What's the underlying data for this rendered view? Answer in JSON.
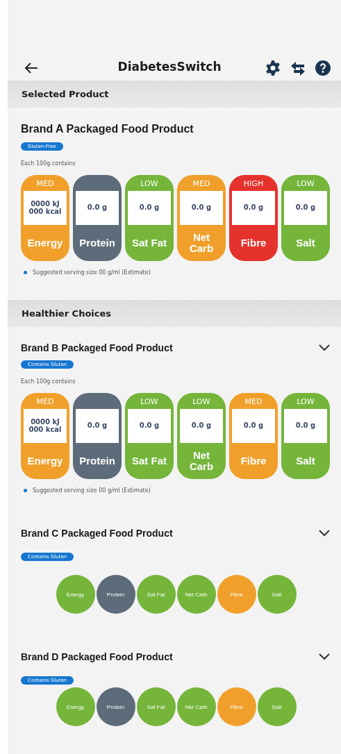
{
  "app_bar": {
    "title": "DiabetesSwitch"
  },
  "sections": [
    {
      "heading": "Selected Product",
      "products": [
        {
          "name": "Brand A Packaged Food Product",
          "kind": "detailed",
          "toggle": false,
          "badge": "Gluten-Free",
          "per": "Each 100g contains",
          "note": "Suggested serving size 00 g/ml (Estimate)",
          "nutrients": [
            {
              "name": "Energy",
              "rating": "MED",
              "amount": "0000 kJ\n000 kcal",
              "color": "#f0a02a"
            },
            {
              "name": "Protein",
              "amount": "0.0 g",
              "color": "#5d6b7a"
            },
            {
              "name": "Sat Fat",
              "rating": "LOW",
              "amount": "0.0 g",
              "color": "#74b53a"
            },
            {
              "name": "Net Carb",
              "rating": "MED",
              "amount": "0.0 g",
              "color": "#f0a02a"
            },
            {
              "name": "Fibre",
              "rating": "HIGH",
              "amount": "0.0 g",
              "color": "#e5322d"
            },
            {
              "name": "Salt",
              "rating": "LOW",
              "amount": "0.0 g",
              "color": "#74b53a"
            }
          ]
        }
      ]
    },
    {
      "heading": "Healthier Choices",
      "products": [
        {
          "name": "Brand B Packaged Food Product",
          "kind": "detailed",
          "toggle": true,
          "badge": "Contains Gluten",
          "per": "Each 100g contains",
          "note": "Suggested serving size 00 g/ml (Estimate)",
          "nutrients": [
            {
              "name": "Energy",
              "rating": "MED",
              "amount": "0000 kJ\n000 kcal",
              "color": "#f0a02a"
            },
            {
              "name": "Protein",
              "amount": "0.0 g",
              "color": "#5d6b7a"
            },
            {
              "name": "Sat Fat",
              "rating": "LOW",
              "amount": "0.0 g",
              "color": "#74b53a"
            },
            {
              "name": "Net Carb",
              "rating": "LOW",
              "amount": "0.0 g",
              "color": "#74b53a"
            },
            {
              "name": "Fibre",
              "rating": "MED",
              "amount": "0.0 g",
              "color": "#f0a02a"
            },
            {
              "name": "Salt",
              "rating": "LOW",
              "amount": "0.0 g",
              "color": "#74b53a"
            }
          ]
        },
        {
          "name": "Brand C Packaged Food Product",
          "kind": "compact",
          "toggle": true,
          "badge": "Contains Gluten",
          "nutrients": [
            {
              "name": "Energy",
              "color": "#74b53a"
            },
            {
              "name": "Protein",
              "color": "#5d6b7a"
            },
            {
              "name": "Sat Fat",
              "color": "#74b53a"
            },
            {
              "name": "Net Carb",
              "color": "#74b53a"
            },
            {
              "name": "Fibre",
              "color": "#f0a02a"
            },
            {
              "name": "Salt",
              "color": "#74b53a"
            }
          ]
        },
        {
          "name": "Brand D Packaged Food Product",
          "kind": "compact",
          "toggle": true,
          "badge": "Contains Gluten",
          "nutrients": [
            {
              "name": "Energy",
              "color": "#74b53a"
            },
            {
              "name": "Protein",
              "color": "#5d6b7a"
            },
            {
              "name": "Sat Fat",
              "color": "#74b53a"
            },
            {
              "name": "Net Carb",
              "color": "#74b53a"
            },
            {
              "name": "Fibre",
              "color": "#f0a02a"
            },
            {
              "name": "Salt",
              "color": "#74b53a"
            }
          ]
        }
      ]
    }
  ]
}
